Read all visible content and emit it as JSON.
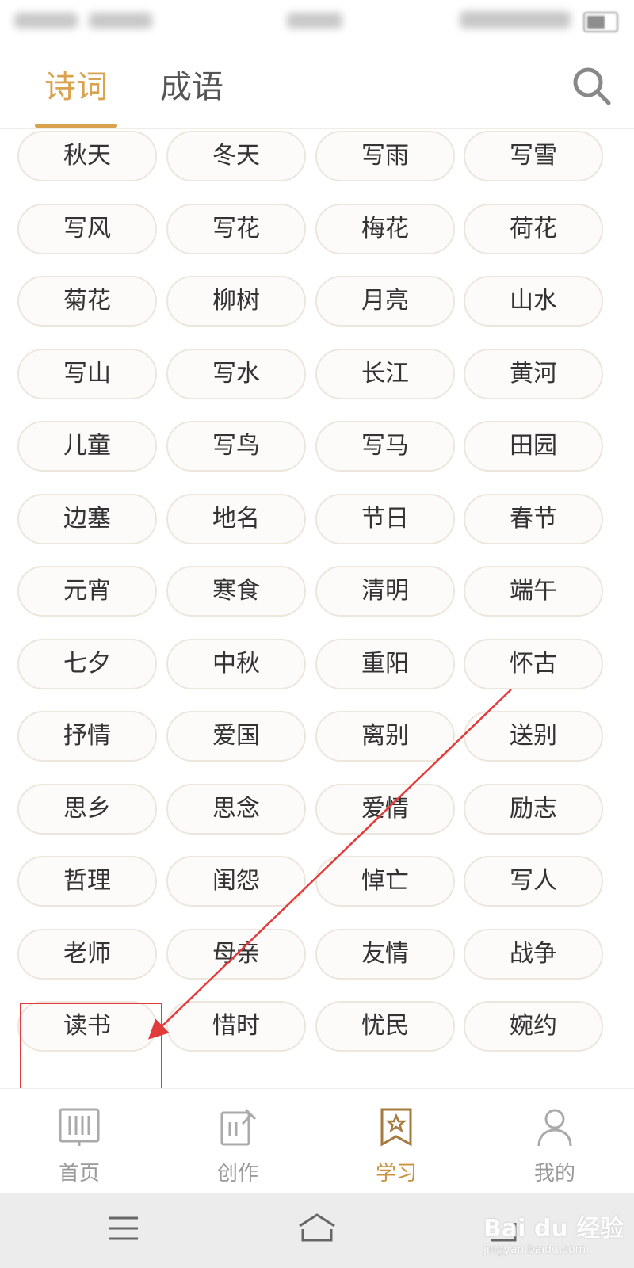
{
  "status_bar": {
    "note_blurred": ""
  },
  "tabs": [
    {
      "label": "诗词",
      "active": true
    },
    {
      "label": "成语",
      "active": false
    }
  ],
  "colors": {
    "accent": "#d8a24e",
    "annotation": "#e23b3b"
  },
  "topics": [
    [
      "秋天",
      "冬天",
      "写雨",
      "写雪"
    ],
    [
      "写风",
      "写花",
      "梅花",
      "荷花"
    ],
    [
      "菊花",
      "柳树",
      "月亮",
      "山水"
    ],
    [
      "写山",
      "写水",
      "长江",
      "黄河"
    ],
    [
      "儿童",
      "写鸟",
      "写马",
      "田园"
    ],
    [
      "边塞",
      "地名",
      "节日",
      "春节"
    ],
    [
      "元宵",
      "寒食",
      "清明",
      "端午"
    ],
    [
      "七夕",
      "中秋",
      "重阳",
      "怀古"
    ],
    [
      "抒情",
      "爱国",
      "离别",
      "送别"
    ],
    [
      "思乡",
      "思念",
      "爱情",
      "励志"
    ],
    [
      "哲理",
      "闺怨",
      "悼亡",
      "写人"
    ],
    [
      "老师",
      "母亲",
      "友情",
      "战争"
    ],
    [
      "读书",
      "惜时",
      "忧民",
      "婉约"
    ]
  ],
  "bottom_nav": [
    {
      "label": "首页",
      "icon": "book-icon",
      "active": false
    },
    {
      "label": "创作",
      "icon": "pen-icon",
      "active": false
    },
    {
      "label": "学习",
      "icon": "bookmark-star-icon",
      "active": true
    },
    {
      "label": "我的",
      "icon": "person-icon",
      "active": false
    }
  ],
  "watermark": {
    "main": "Bai du 经验",
    "sub": "jingyan.baidu.com"
  }
}
